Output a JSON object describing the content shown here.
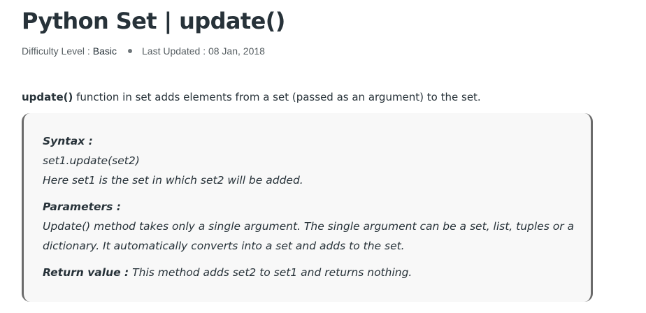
{
  "article": {
    "title": "Python Set | update()",
    "difficulty_label": "Difficulty Level :",
    "difficulty_value": "Basic",
    "last_updated": "Last Updated : 08 Jan, 2018"
  },
  "intro": {
    "code": "update()",
    "text": " function in set adds elements from a set (passed as an argument) to the set."
  },
  "box": {
    "syntax_label": "Syntax :",
    "syntax_code": "set1.update(set2)",
    "syntax_desc": "Here set1 is the set in which set2 will be added.",
    "parameters_label": "Parameters :",
    "parameters_line1": "Update() method takes only a single argument. The single argument can be a set, list, tuples or a",
    "parameters_line2": "dictionary. It automatically converts into a set and adds to the set.",
    "return_label": "Return value :",
    "return_text": " This method adds set2 to set1 and returns nothing."
  }
}
